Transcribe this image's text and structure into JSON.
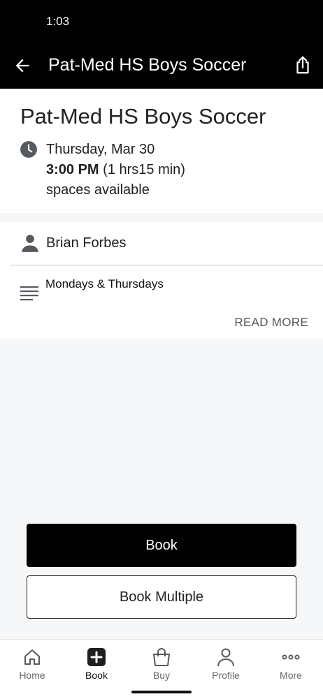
{
  "status": {
    "time": "1:03"
  },
  "appbar": {
    "title": "Pat-Med HS Boys Soccer",
    "back_icon": "arrow-left-icon",
    "share_icon": "share-icon"
  },
  "event": {
    "title": "Pat-Med HS Boys Soccer",
    "date": "Thursday, Mar 30",
    "start_time": "3:00 PM",
    "duration": "(1 hrs15 min)",
    "availability": "spaces available"
  },
  "details": {
    "instructor": "Brian Forbes",
    "description": "Mondays & Thursdays",
    "read_more": "READ MORE"
  },
  "actions": {
    "book": "Book",
    "book_multiple": "Book Multiple"
  },
  "nav": {
    "items": [
      {
        "label": "Home",
        "icon": "home-icon"
      },
      {
        "label": "Book",
        "icon": "plus-square-icon"
      },
      {
        "label": "Buy",
        "icon": "shopping-bag-icon"
      },
      {
        "label": "Profile",
        "icon": "person-icon"
      },
      {
        "label": "More",
        "icon": "more-horizontal-icon"
      }
    ],
    "active": "Book"
  },
  "colors": {
    "primary": "#000000",
    "background": "#f6f7f9",
    "icon_gray": "#555a60"
  }
}
